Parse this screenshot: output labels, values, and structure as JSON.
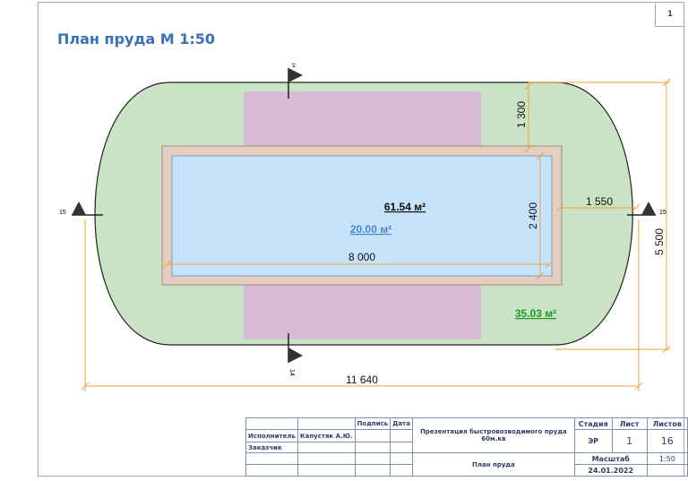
{
  "title": "План пруда М 1:50",
  "sheet_number": "1",
  "dimensions": {
    "width_total": "11 640",
    "pond_length": "8 000",
    "pond_width": "2 400",
    "height_total": "5 500",
    "top_offset": "1 300",
    "side_offset": "1 550"
  },
  "areas": {
    "total": "61.54 м²",
    "water": "20.00 м²",
    "green": "35.03 м²"
  },
  "section_marks": {
    "top": "14",
    "bottom": "14",
    "left": "15",
    "right": "15"
  },
  "colors": {
    "green_zone": "#c9e3c4",
    "deck": "#d8bcd3",
    "pond_border": "#e6cdbd",
    "water": "#c7e2fb",
    "dimension": "#f2a23a",
    "title": "#3b6fb8"
  },
  "stamp": {
    "col_headers": {
      "podpis": "Подпись",
      "data": "Дата"
    },
    "ispolnitel_label": "Исполнитель",
    "ispolnitel_name": "Капустяк А.Ю.",
    "zakazchik_label": "Заказчик",
    "presentation": "Презентация быстровозводимого пруда 60м.кв",
    "plan_name": "План пруда",
    "stadiya_label": "Стадия",
    "list_label": "Лист",
    "listov_label": "Листов",
    "stadiya_value": "ЭР",
    "list_value": "1",
    "listov_value": "16",
    "masshtab_label": "Масштаб",
    "masshtab_value": "1:50",
    "date": "24.01.2022"
  }
}
